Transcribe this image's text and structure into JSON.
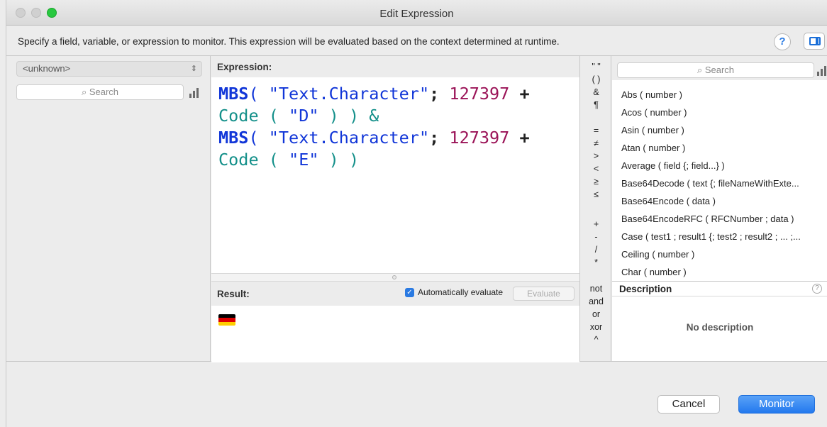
{
  "window": {
    "title": "Edit Expression"
  },
  "info": {
    "text": "Specify a field, variable, or expression to monitor. This expression will be evaluated based on the context determined at runtime.",
    "help_label": "?"
  },
  "left_panel": {
    "table_selector": "<unknown>",
    "search_placeholder": "Search"
  },
  "expression": {
    "heading": "Expression:",
    "line1": {
      "fn": "MBS",
      "paren": "( ",
      "str": "\"Text.Character\"",
      "semi": "; ",
      "num": "127397",
      "plus": " +"
    },
    "line2": {
      "fn": "Code",
      "rest": " ( ",
      "str": "\"D\"",
      "close": " ) ) &"
    },
    "line3": {
      "fn": "MBS",
      "paren": "( ",
      "str": "\"Text.Character\"",
      "semi": "; ",
      "num": "127397",
      "plus": " +"
    },
    "line4": {
      "fn": "Code",
      "rest": " ( ",
      "str": "\"E\"",
      "close": " ) )"
    }
  },
  "result": {
    "heading": "Result:",
    "auto_evaluate_label": "Automatically evaluate",
    "auto_evaluate_checked": true,
    "evaluate_label": "Evaluate",
    "value_flag": "Germany flag (🇩🇪)"
  },
  "operators": [
    "\" \"",
    "( )",
    "&",
    "¶",
    "=",
    "≠",
    ">",
    "<",
    "≥",
    "≤",
    "+",
    "-",
    "/",
    "*",
    "not",
    "and",
    "or",
    "xor",
    "^"
  ],
  "functions_panel": {
    "search_placeholder": "Search",
    "items": [
      "Abs ( number )",
      "Acos ( number )",
      "Asin ( number )",
      "Atan ( number )",
      "Average ( field {; field...} )",
      "Base64Decode ( text {; fileNameWithExte...",
      "Base64Encode ( data )",
      "Base64EncodeRFC ( RFCNumber ; data )",
      "Case ( test1 ; result1 {; test2 ; result2 ; ... ;...",
      "Ceiling ( number )",
      "Char ( number )"
    ],
    "description_heading": "Description",
    "description_text": "No description"
  },
  "buttons": {
    "cancel": "Cancel",
    "monitor": "Monitor"
  },
  "colors": {
    "accent": "#2379ee",
    "keyword": "#1136d8",
    "number": "#9b1458",
    "function": "#14908a"
  }
}
